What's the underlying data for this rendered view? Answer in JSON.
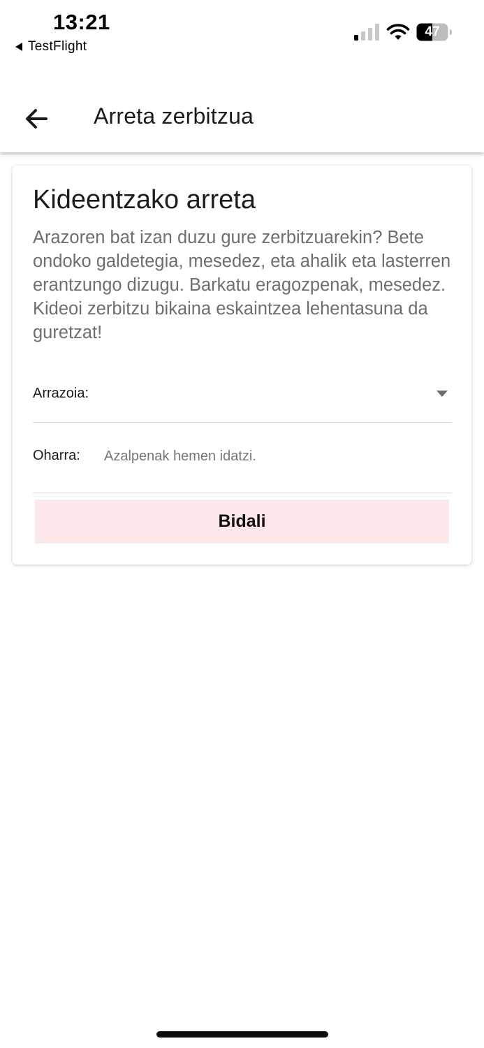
{
  "status_bar": {
    "time": "13:21",
    "back_app_label": "TestFlight",
    "battery_level": "47",
    "signal_icon": "cellular-signal-icon",
    "wifi_icon": "wifi-icon",
    "battery_icon": "battery-icon"
  },
  "app_bar": {
    "back_icon": "arrow-left-icon",
    "title": "Arreta zerbitzua"
  },
  "card": {
    "title": "Kideentzako arreta",
    "description": "Arazoren bat izan duzu gure zerbitzuarekin? Bete ondoko galdetegia, mesedez, eta ahalik eta lasterren erantzungo dizugu. Barkatu eragozpenak, mesedez. Kideoi zerbitzu bikaina eskaintzea lehentasuna da guretzat!",
    "reason": {
      "label": "Arrazoia:",
      "selected_value": "",
      "icon": "dropdown-arrow-icon"
    },
    "note": {
      "label": "Oharra:",
      "value": "",
      "placeholder": "Azalpenak hemen idatzi."
    },
    "submit_label": "Bidali"
  },
  "colors": {
    "submit_background": "#fbe6e8",
    "description_text": "#6e6e6e",
    "divider": "#d6d6d6"
  }
}
